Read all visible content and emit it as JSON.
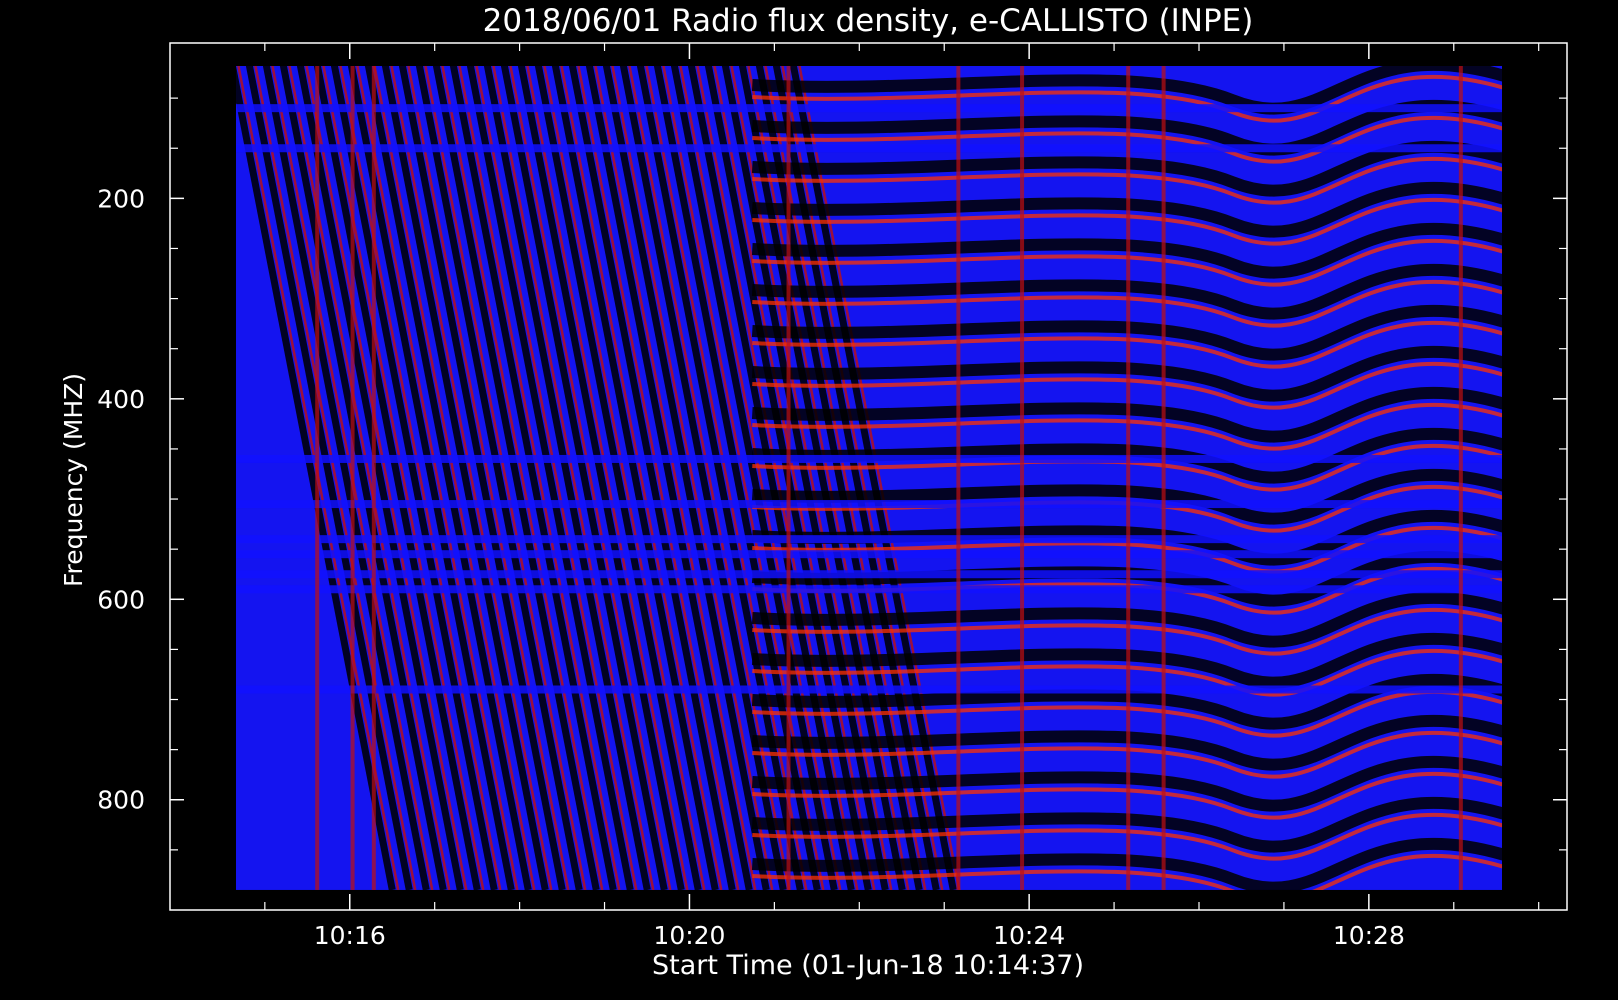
{
  "chart_data": {
    "type": "heatmap",
    "title": "2018/06/01  Radio flux density, e-CALLISTO (INPE)",
    "xlabel": "Start Time (01-Jun-18 10:14:37)",
    "ylabel": "Frequency (MHZ)",
    "x_start": "10:14:37",
    "x_end": "10:29:45",
    "xlim": [
      "10:13:53",
      "10:30:20"
    ],
    "ylim": [
      45,
      910
    ],
    "y_inverted": true,
    "data_yrange": [
      67,
      890
    ],
    "x_ticks": [
      "10:16",
      "10:20",
      "10:24",
      "10:28"
    ],
    "x_minor_ticks": [
      "10:15",
      "10:17",
      "10:18",
      "10:19",
      "10:21",
      "10:22",
      "10:23",
      "10:25",
      "10:26",
      "10:27",
      "10:29",
      "10:30"
    ],
    "y_ticks": [
      200,
      400,
      600,
      800
    ],
    "colormap": [
      "#000000",
      "#1010ff",
      "#c01010",
      "#ff3000",
      "#ffb060"
    ]
  }
}
